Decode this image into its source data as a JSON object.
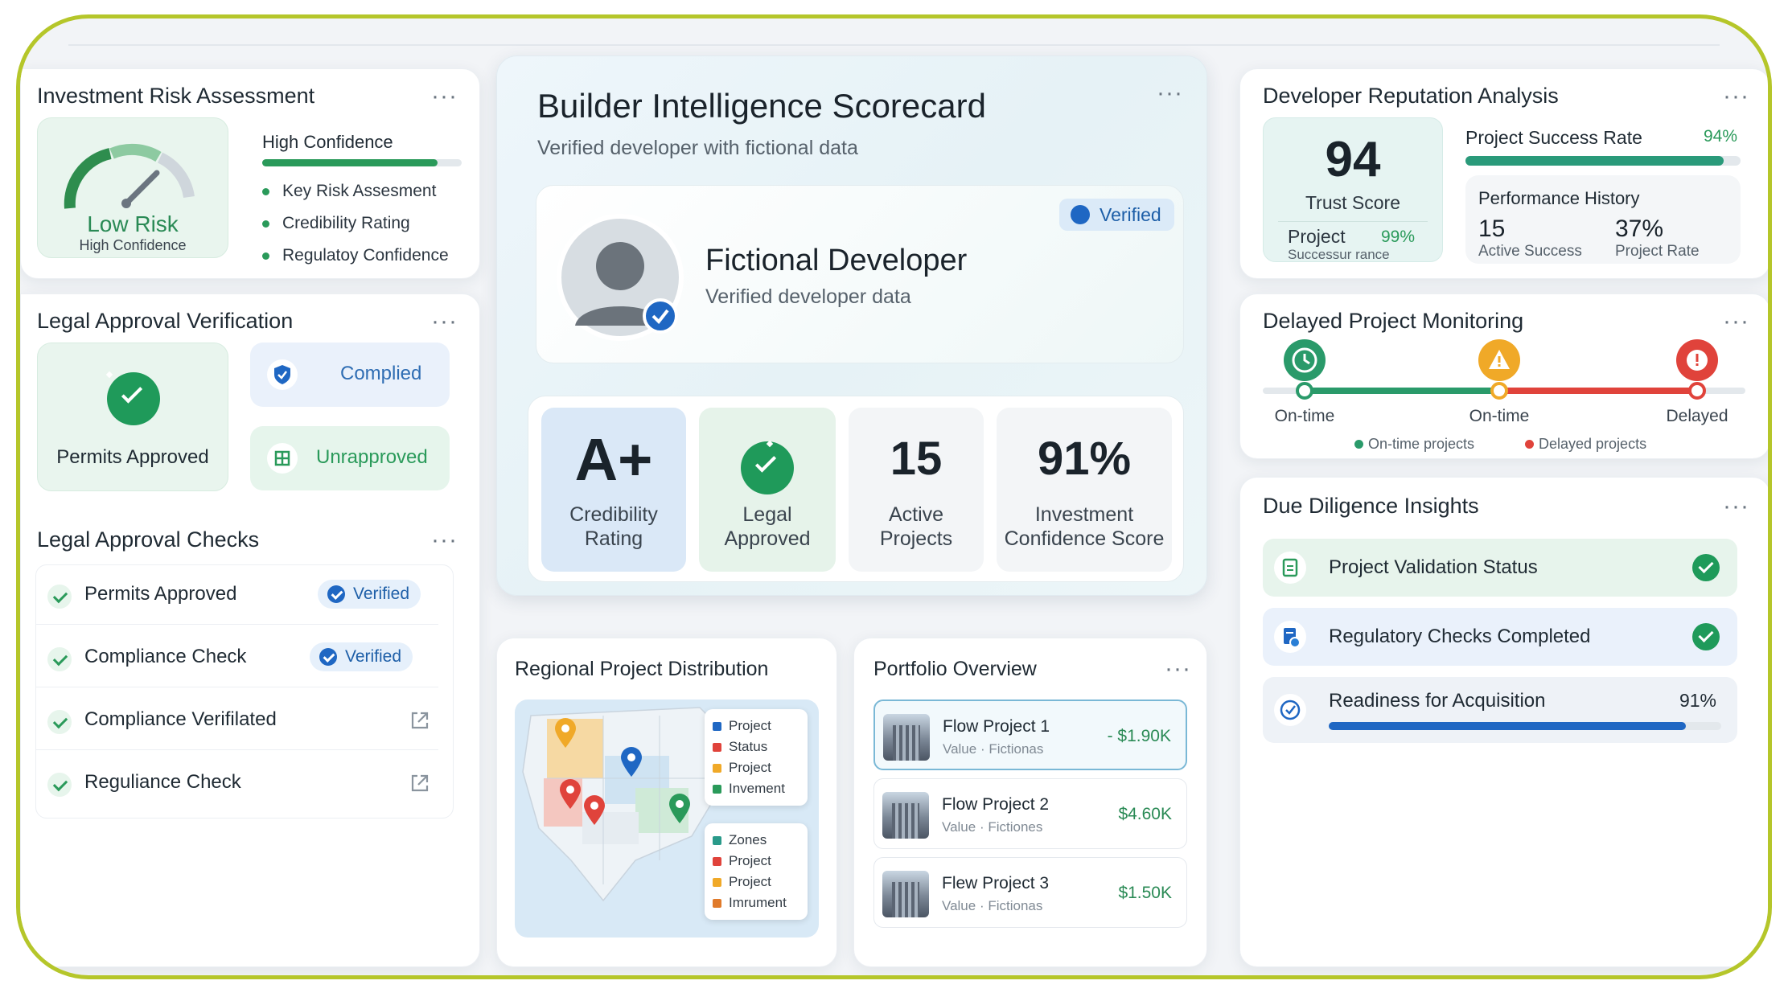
{
  "colors": {
    "frame_border": "#b5c62a",
    "green": "#1f9a5a",
    "blue": "#1f67c3",
    "red": "#e0433b",
    "amber": "#f0a928",
    "teal": "#2a9a8a"
  },
  "menu_icon": "···",
  "risk": {
    "title": "Investment Risk Assessment",
    "gauge_level": "Low Risk",
    "gauge_sub": "High Confidence",
    "confidence_label": "High Confidence",
    "confidence_fraction": 0.88,
    "bullets": [
      "Key Risk Assesment",
      "Credibility Rating",
      "Regulatoy Confidence"
    ]
  },
  "legal_verification": {
    "title": "Legal Approval Verification",
    "permits": "Permits Approved",
    "complied": "Complied",
    "unapproved": "Unrapproved"
  },
  "legal_checks": {
    "title": "Legal Approval Checks",
    "rows": [
      {
        "label": "Permits Approved",
        "status": "Verified"
      },
      {
        "label": "Compliance Check",
        "status": "Verified"
      },
      {
        "label": "Compliance Verifilated",
        "status": ""
      },
      {
        "label": "Reguliance Check",
        "status": ""
      }
    ]
  },
  "scorecard": {
    "title": "Builder Intelligence Scorecard",
    "subtitle": "Verified developer with fictional data",
    "badge": "Verified",
    "developer_name": "Fictional Developer",
    "developer_sub": "Verified developer data",
    "metrics": [
      {
        "value": "A+",
        "label_line1": "Credibility",
        "label_line2": "Rating"
      },
      {
        "value": "",
        "label_line1": "Legal",
        "label_line2": "Approved"
      },
      {
        "value": "15",
        "label_line1": "Active",
        "label_line2": "Projects"
      },
      {
        "value": "91%",
        "label_line1": "Investment",
        "label_line2": "Confidence Score"
      }
    ]
  },
  "regional": {
    "title": "Regional Project Distribution",
    "legend1": [
      "Project",
      "Status",
      "Project",
      "Invement"
    ],
    "legend2": [
      "Zones",
      "Project",
      "Project",
      "Imrument"
    ]
  },
  "portfolio": {
    "title": "Portfolio Overview",
    "projects": [
      {
        "name": "Flow Project 1",
        "sub": "Value · Fictionas",
        "value": "- $1.90K"
      },
      {
        "name": "Flow Project 2",
        "sub": "Value · Fictiones",
        "value": "$4.60K"
      },
      {
        "name": "Flew Project 3",
        "sub": "Value · Fictionas",
        "value": "$1.50K"
      }
    ]
  },
  "reputation": {
    "title": "Developer Reputation Analysis",
    "trust_score": "94",
    "trust_label": "Trust Score",
    "project_label": "Project",
    "project_pct": "99%",
    "project_sub": "Successur rance",
    "success_rate_label": "Project Success Rate",
    "success_rate_value": "94%",
    "success_rate_fraction": 0.94,
    "history_title": "Performance History",
    "history_left_value": "15",
    "history_left_label": "Active Success",
    "history_right_value": "37%",
    "history_right_label": "Project Rate"
  },
  "delayed": {
    "title": "Delayed Project Monitoring",
    "nodes": [
      "On-time",
      "On-time",
      "Delayed"
    ],
    "legend_ontime": "On-time projects",
    "legend_delayed": "Delayed projects"
  },
  "due_diligence": {
    "title": "Due Diligence Insights",
    "row1": "Project Validation Status",
    "row2": "Regulatory Checks Completed",
    "row3": "Readiness for Acquisition",
    "row3_value": "91%",
    "row3_fraction": 0.91
  }
}
